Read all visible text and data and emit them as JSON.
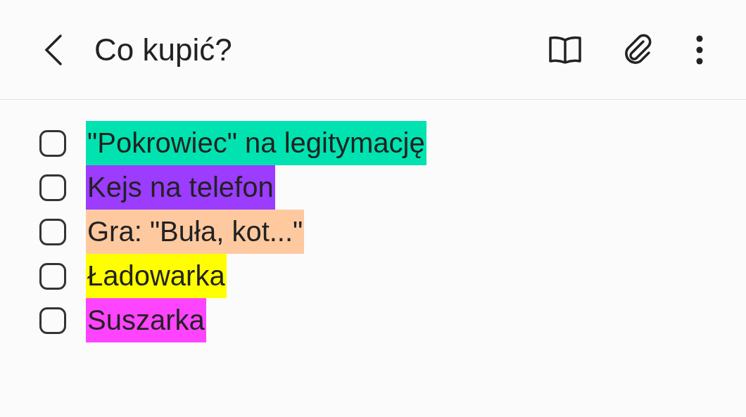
{
  "header": {
    "title": "Co kupić?"
  },
  "items": [
    {
      "text": "\"Pokrowiec\" na legitymację",
      "checked": false,
      "color": "#00e3b0"
    },
    {
      "text": "Kejs na telefon",
      "checked": false,
      "color": "#9b3cff"
    },
    {
      "text": "Gra: \"Buła, kot...\"",
      "checked": false,
      "color": "#ffc9a0"
    },
    {
      "text": "Ładowarka",
      "checked": false,
      "color": "#ffff00"
    },
    {
      "text": "Suszarka",
      "checked": false,
      "color": "#ff44ff"
    }
  ]
}
